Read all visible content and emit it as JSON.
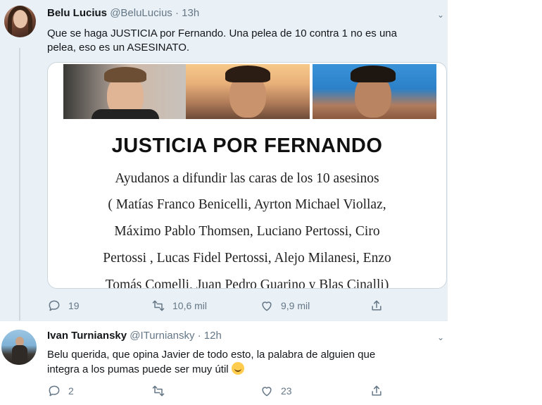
{
  "tweets": [
    {
      "display_name": "Belu Lucius",
      "handle": "@BeluLucius",
      "time": "· 13h",
      "text_lines": [
        "Que se haga JUSTICIA por Fernando. Una pelea de 10 contra 1 no es una",
        "pelea, eso es un ASESINATO."
      ],
      "card": {
        "title": "JUSTICIA POR FERNANDO",
        "lines": [
          "Ayudanos a difundir las caras de los 10 asesinos",
          "( Matías Franco Benicelli, Ayrton Michael Viollaz,",
          "Máximo Pablo Thomsen, Luciano Pertossi, Ciro",
          "Pertossi , Lucas Fidel Pertossi, Alejo Milanesi, Enzo",
          "Tomás Comelli, Juan Pedro Guarino y Blas Cinalli)"
        ]
      },
      "stats": {
        "replies": "19",
        "retweets": "10,6 mil",
        "likes": "9,9 mil"
      }
    },
    {
      "display_name": "Ivan Turniansky",
      "handle": "@ITurniansky",
      "time": "· 12h",
      "text_lines": [
        "Belu querida, que opina Javier de todo esto, la palabra de alguien  que",
        "integra a los pumas puede ser muy útil"
      ],
      "emoji": "grinning-face",
      "stats": {
        "replies": "2",
        "retweets": "",
        "likes": "23"
      }
    }
  ],
  "icons": [
    "reply-icon",
    "retweet-icon",
    "like-icon",
    "share-icon",
    "caret-down-icon"
  ],
  "colors": {
    "thread_bg": "#e9f0f6",
    "muted_text": "#657786",
    "border": "#ccd6dd"
  }
}
